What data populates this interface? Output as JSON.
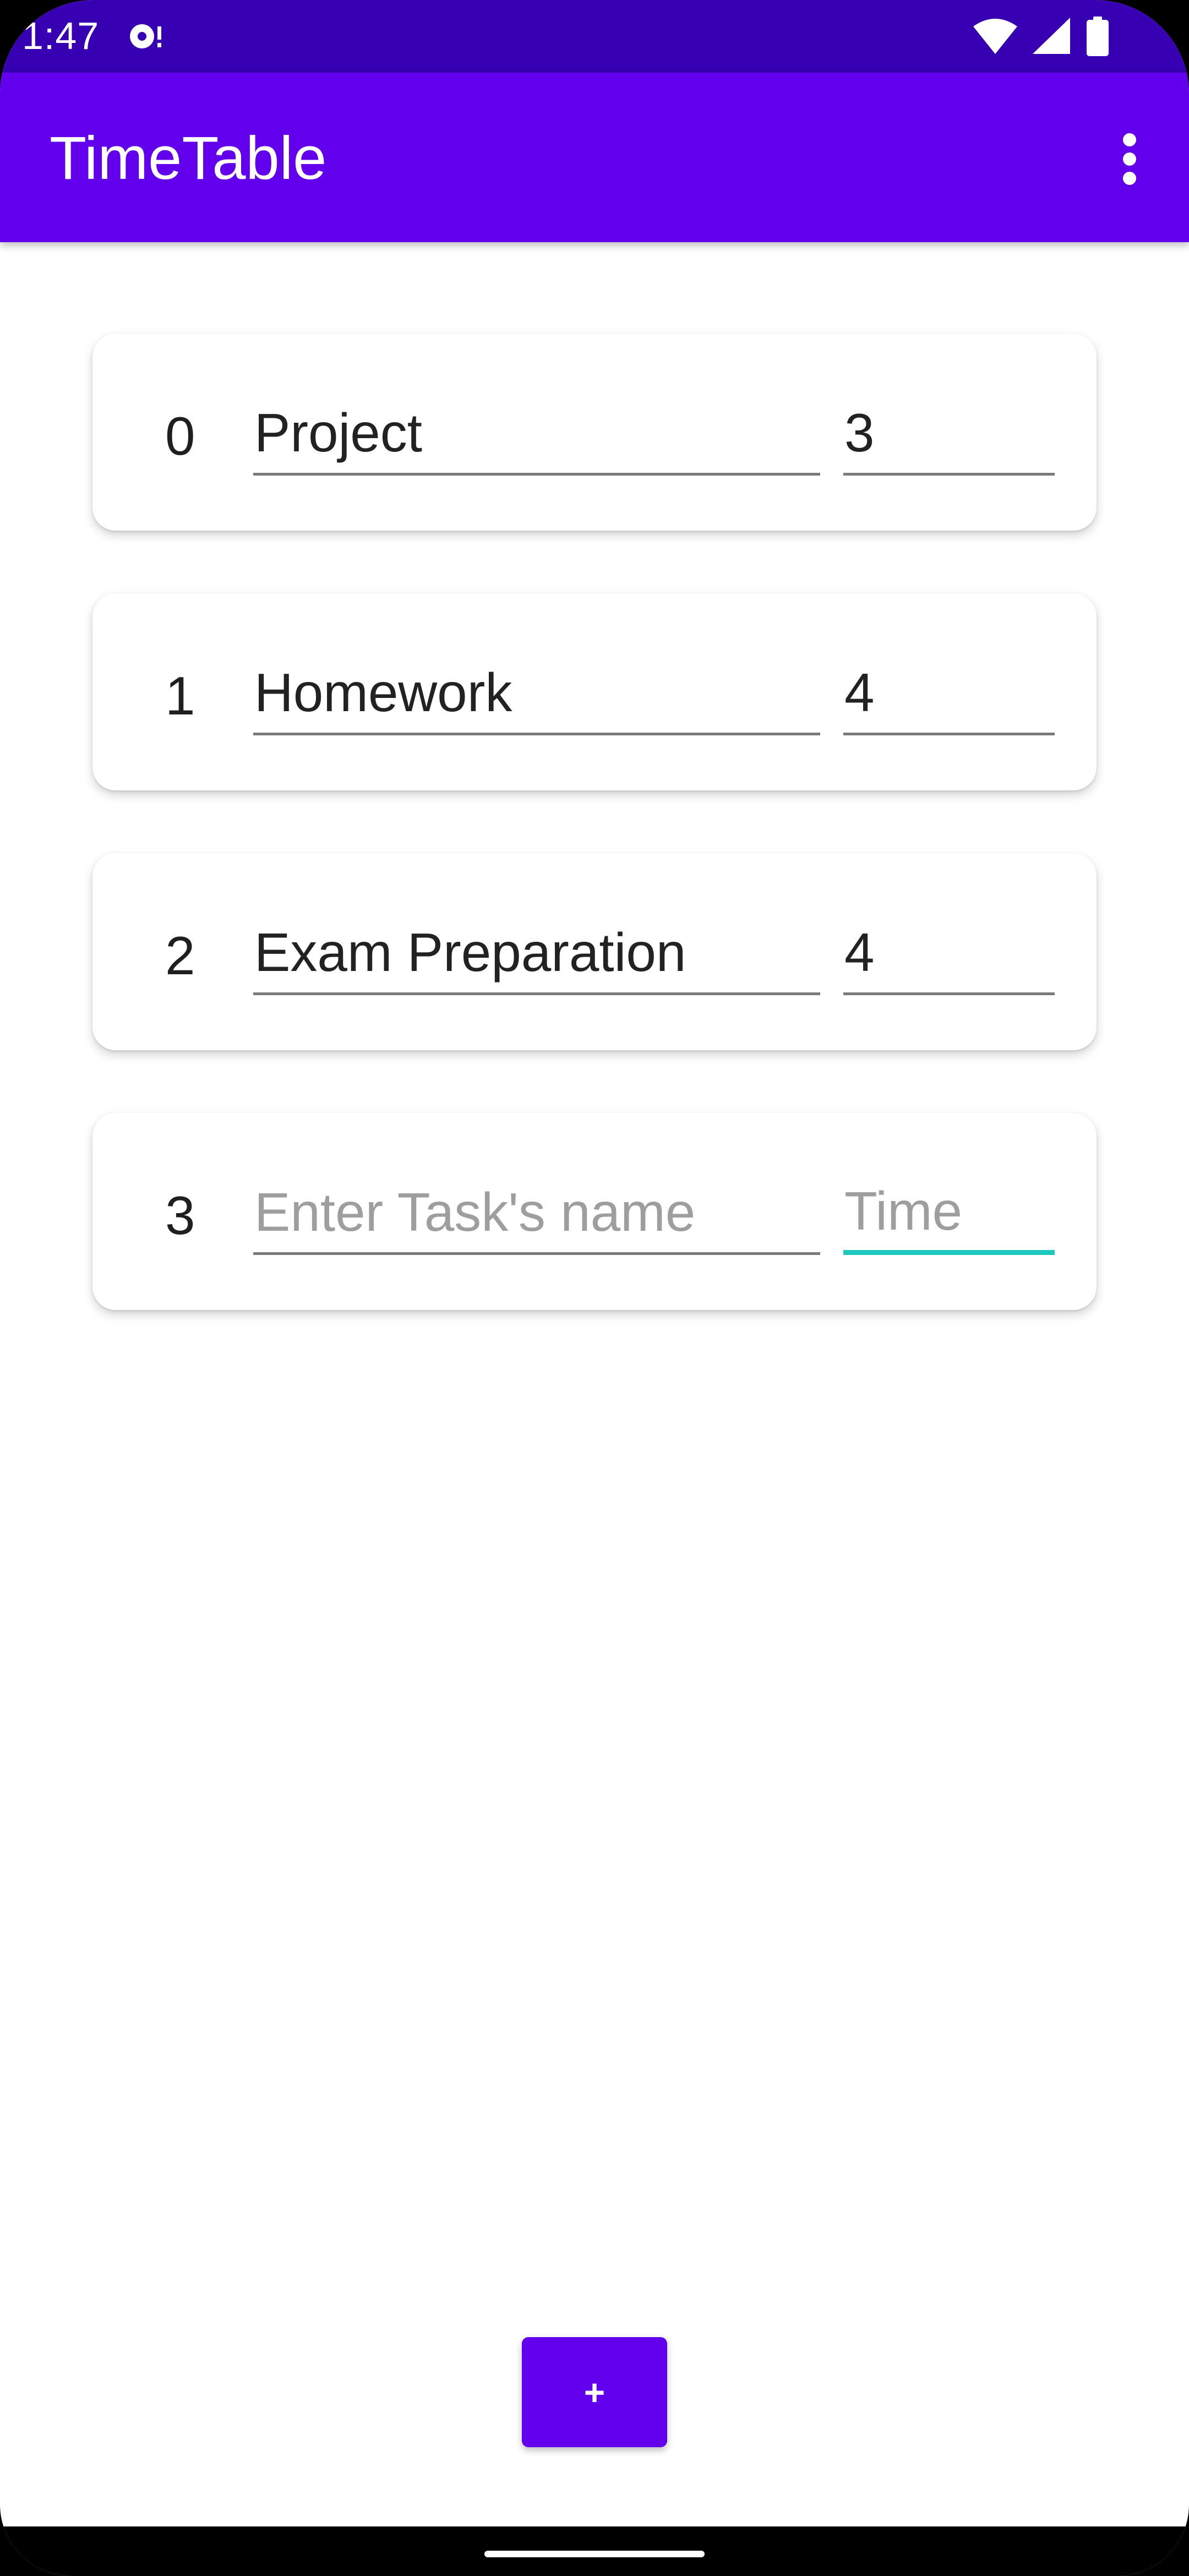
{
  "status_bar": {
    "time": "1:47",
    "icons": [
      "notification-icon",
      "wifi-icon",
      "signal-icon",
      "battery-icon"
    ]
  },
  "app_bar": {
    "title": "TimeTable",
    "menu_icon": "more-vert-icon"
  },
  "tasks": [
    {
      "index": "0",
      "name": "Project",
      "time": "3"
    },
    {
      "index": "1",
      "name": "Homework",
      "time": "4"
    },
    {
      "index": "2",
      "name": "Exam Preparation",
      "time": "4"
    },
    {
      "index": "3",
      "name": "",
      "time": "",
      "name_placeholder": "Enter Task's name",
      "time_placeholder": "Time"
    }
  ],
  "add_button": {
    "label": "+"
  },
  "colors": {
    "status_bar": "#3700b3",
    "primary": "#6200ee",
    "focus_accent": "#1fc8be"
  }
}
